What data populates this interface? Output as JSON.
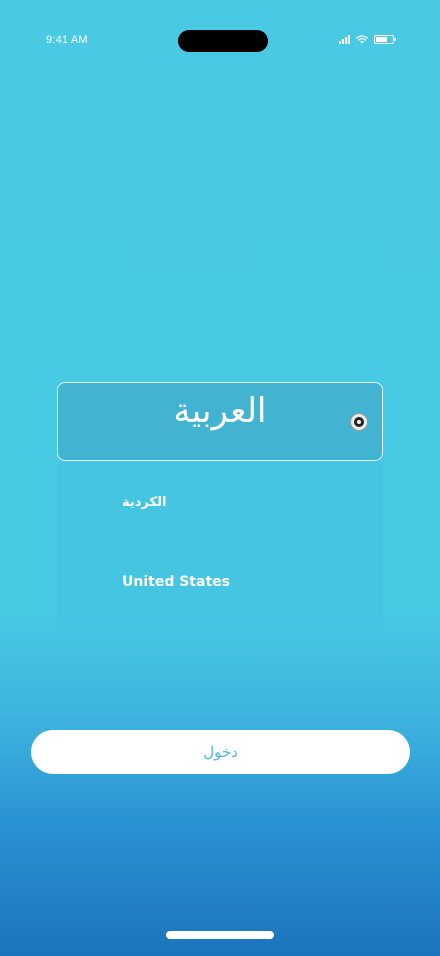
{
  "status_bar": {
    "time": "9:41 AM",
    "icons": [
      "signal-icon",
      "wifi-icon",
      "battery-icon"
    ]
  },
  "language_picker": {
    "selected": {
      "label": "العربية",
      "icon": "radio-selected-icon"
    },
    "options": [
      {
        "label": "الكردية"
      },
      {
        "label": "United States"
      }
    ]
  },
  "login": {
    "label": "دخول"
  },
  "colors": {
    "background_top": "#49c9e4",
    "background_bottom": "#1c74bc",
    "button_background": "#ffffff",
    "button_text": "#4cb8dc",
    "text": "#ffffff"
  }
}
